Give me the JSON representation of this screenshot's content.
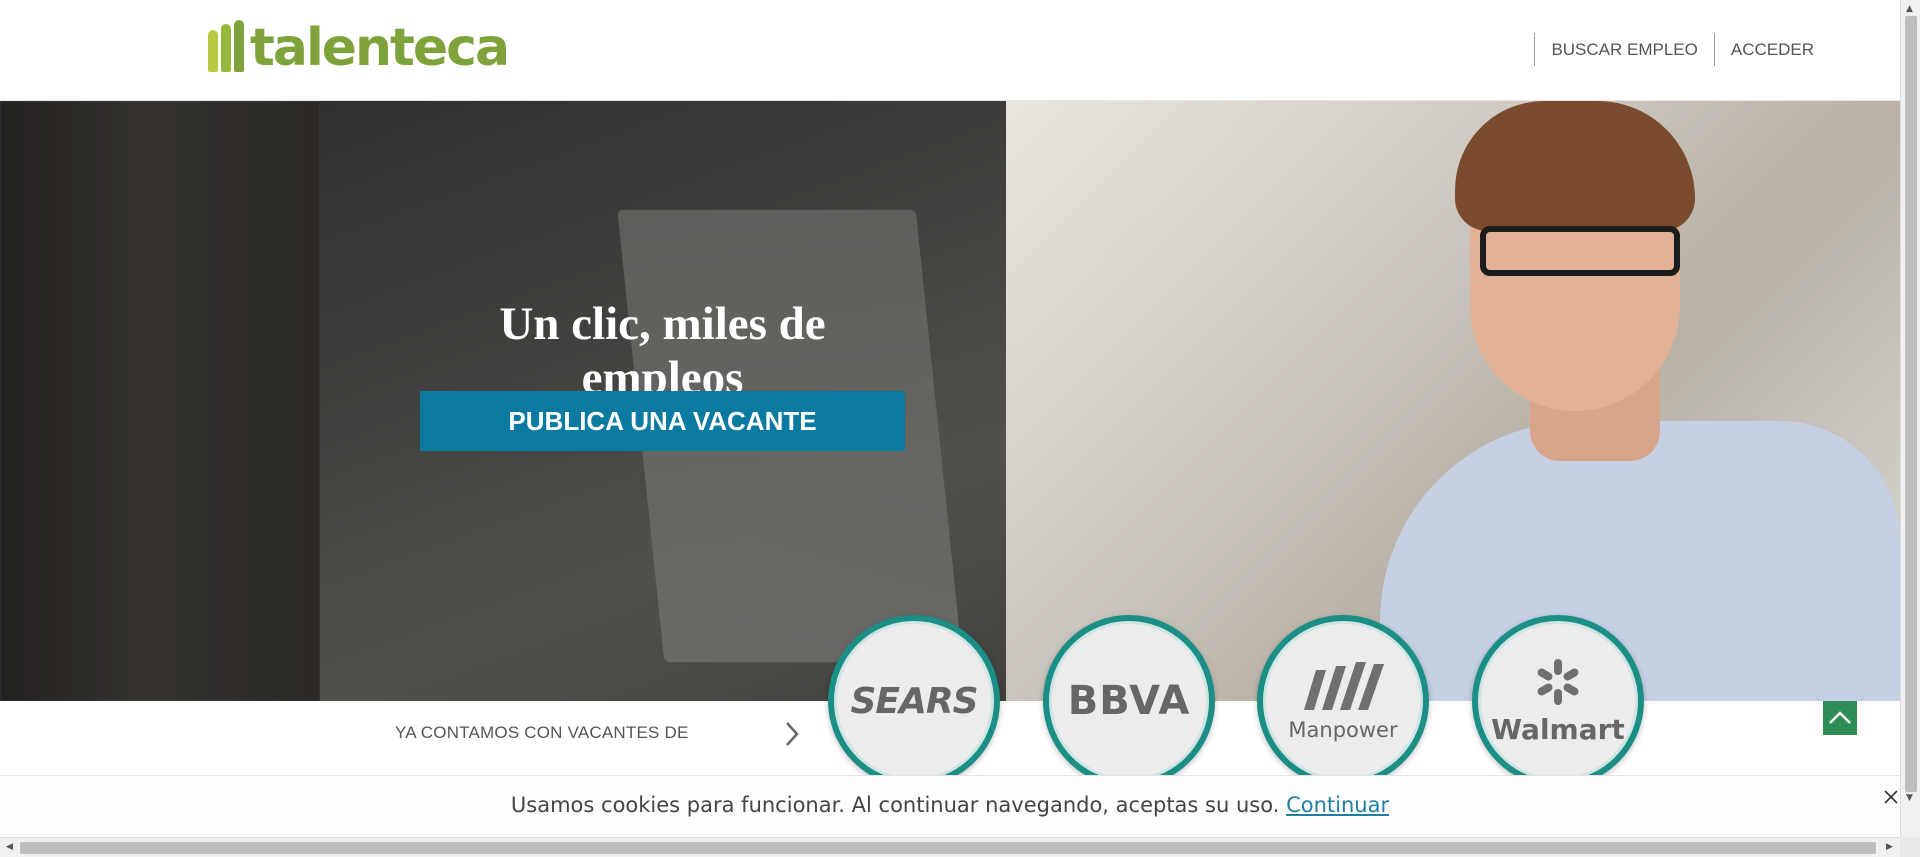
{
  "header": {
    "logo_text": "talenteca",
    "nav": [
      {
        "label": "BUSCAR EMPLEO"
      },
      {
        "label": "ACCEDER"
      }
    ]
  },
  "hero": {
    "headline": "Un clic, miles de empleos",
    "cta_label": "PUBLICA UNA VACANTE"
  },
  "brands": {
    "label": "YA CONTAMOS CON VACANTES DE",
    "items": [
      {
        "name": "SEARS"
      },
      {
        "name": "BBVA"
      },
      {
        "name": "Manpower"
      },
      {
        "name": "Walmart"
      }
    ]
  },
  "cookie": {
    "message": "Usamos cookies para funcionar. Al continuar navegando, aceptas su uso.",
    "link_label": "Continuar"
  },
  "icons": {
    "logo": "talenteca-logo-mark",
    "chevron": "chevron-right-icon",
    "to_top": "chevron-up-icon",
    "close": "close-icon"
  },
  "colors": {
    "brand_green": "#7ea33b",
    "cta_blue": "#0b7aa0",
    "brand_ring": "#1b8f85",
    "to_top_green": "#2f8e58",
    "cookie_link": "#1e7fa3"
  }
}
